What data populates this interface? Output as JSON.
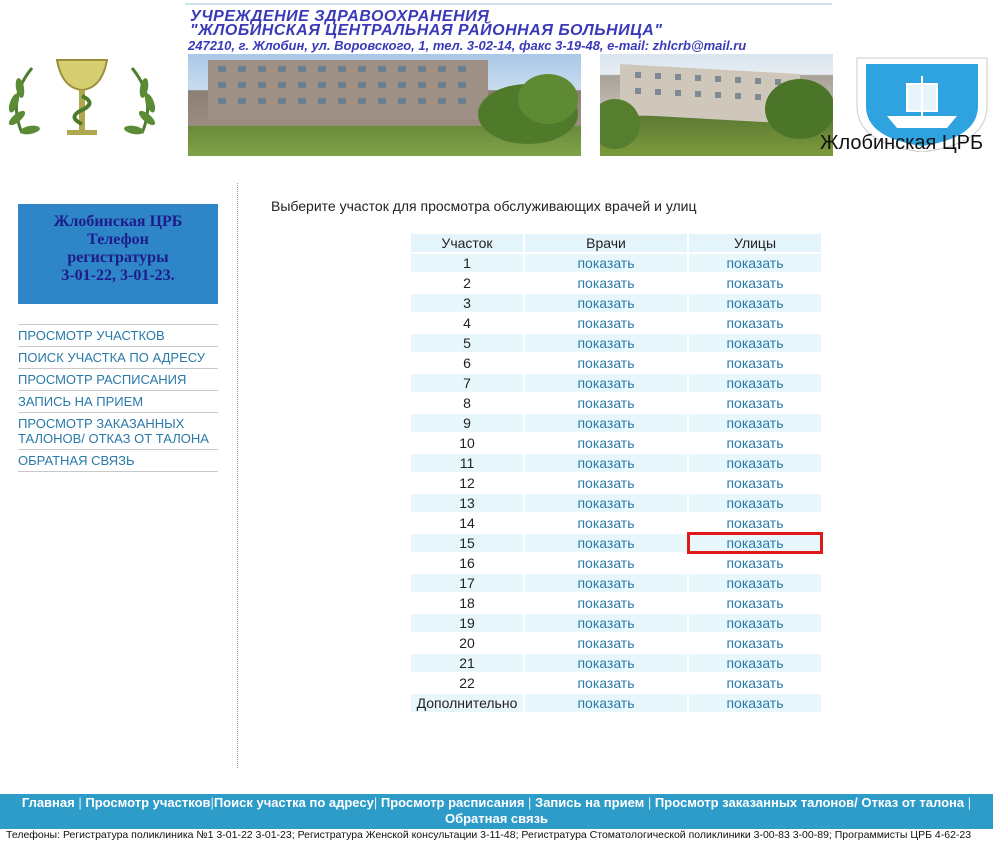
{
  "header": {
    "org_line1": "УЧРЕЖДЕНИЕ ЗДРАВООХРАНЕНИЯ",
    "org_line2": "\"ЖЛОБИНСКАЯ ЦЕНТРАЛЬНАЯ РАЙОННАЯ БОЛЬНИЦА\"",
    "address": "247210, г. Жлобин, ул. Воровского, 1, тел. 3-02-14, факс 3-19-48, e-mail: zhlcrb@mail.ru",
    "site_label": "Жлобинская ЦРБ"
  },
  "sidebar": {
    "phone_box": [
      "Жлобинская ЦРБ",
      "Телефон",
      "регистратуры",
      "3-01-22, 3-01-23."
    ],
    "menu": [
      "ПРОСМОТР УЧАСТКОВ",
      "ПОИСК УЧАСТКА ПО АДРЕСУ",
      "ПРОСМОТР РАСПИСАНИЯ",
      "ЗАПИСЬ НА ПРИЕМ",
      "ПРОСМОТР ЗАКАЗАННЫХ ТАЛОНОВ/ ОТКАЗ ОТ ТАЛОНА",
      "ОБРАТНАЯ СВЯЗЬ"
    ]
  },
  "main": {
    "intro": "Выберите участок для просмотра обслуживающих врачей и улиц",
    "columns": [
      "Участок",
      "Врачи",
      "Улицы"
    ],
    "link_text": "показать",
    "rows": [
      "1",
      "2",
      "3",
      "4",
      "5",
      "6",
      "7",
      "8",
      "9",
      "10",
      "11",
      "12",
      "13",
      "14",
      "15",
      "16",
      "17",
      "18",
      "19",
      "20",
      "21",
      "22",
      "Дополнительно"
    ],
    "highlighted_row": "15"
  },
  "footer": {
    "links": [
      "Главная",
      "Просмотр участков",
      "Поиск участка по адресу",
      "Просмотр расписания",
      "Запись на прием",
      "Просмотр заказанных талонов/ Отказ от талона",
      "Обратная связь"
    ],
    "phones": "Телефоны: Регистратура поликлиника №1 3-01-22 3-01-23; Регистратура Женской консультации 3-11-48; Регистратура Стоматологической поликлиники 3-00-83 3-00-89; Программисты ЦРБ 4-62-23"
  },
  "colors": {
    "accent": "#2d9cc9",
    "link": "#2a7aa8",
    "title": "#3a3ab8",
    "highlight": "#e01818"
  }
}
